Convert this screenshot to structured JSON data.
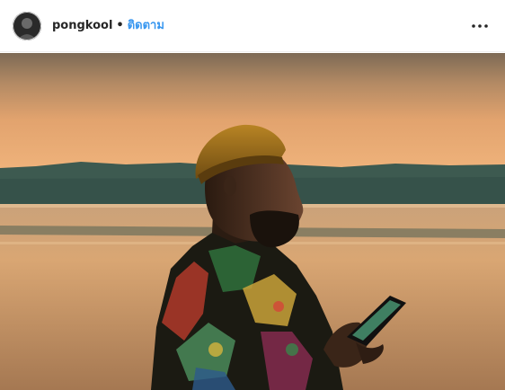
{
  "post": {
    "username": "pongkool",
    "separator": "•",
    "follow_label": "ติดตาม",
    "more_icon": "more-options-icon",
    "avatar_icon": "profile-avatar"
  },
  "colors": {
    "follow": "#3897f0",
    "username": "#262626",
    "divider": "#efefef"
  }
}
